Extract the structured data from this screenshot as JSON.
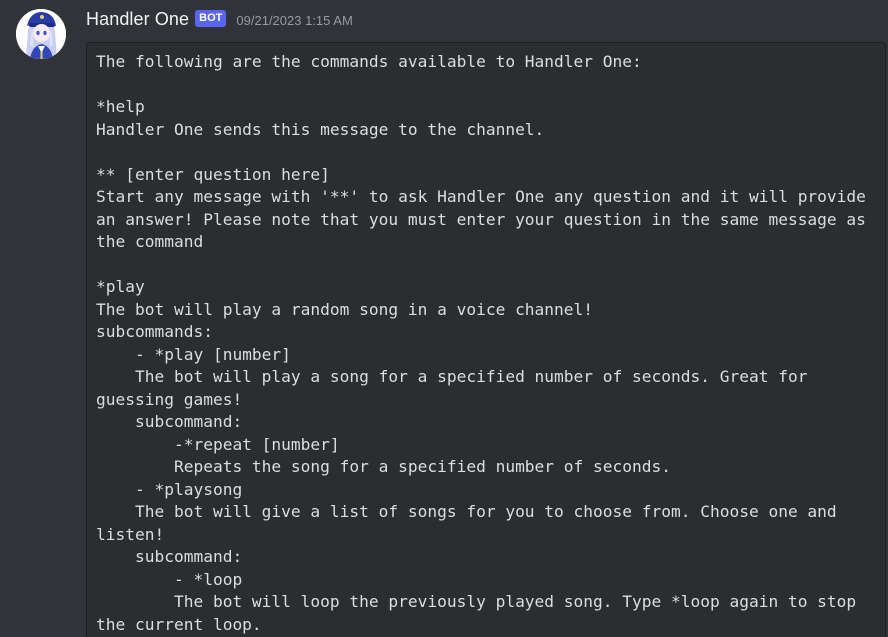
{
  "message": {
    "author": "Handler One",
    "bot_tag": "BOT",
    "timestamp": "09/21/2023 1:15 AM",
    "avatar_icon": "anime-character-avatar",
    "code_lines": [
      "The following are the commands available to Handler One:",
      "",
      "*help",
      "Handler One sends this message to the channel.",
      "",
      "** [enter question here]",
      "Start any message with '**' to ask Handler One any question and it will provide",
      "an answer! Please note that you must enter your question in the same message as",
      "the command",
      "",
      "*play",
      "The bot will play a random song in a voice channel!",
      "subcommands:",
      "    - *play [number]",
      "    The bot will play a song for a specified number of seconds. Great for",
      "guessing games!",
      "    subcommand:",
      "        -*repeat [number]",
      "        Repeats the song for a specified number of seconds.",
      "    - *playsong",
      "    The bot will give a list of songs for you to choose from. Choose one and",
      "listen!",
      "    subcommand:",
      "        - *loop",
      "        The bot will loop the previously played song. Type *loop again to stop",
      "the current loop."
    ]
  },
  "colors": {
    "background": "#313338",
    "codeblock_bg": "#2b2d31",
    "text": "#dbdee1",
    "username": "#f2f3f5",
    "bot_tag": "#5865f2",
    "timestamp": "#949ba4"
  }
}
